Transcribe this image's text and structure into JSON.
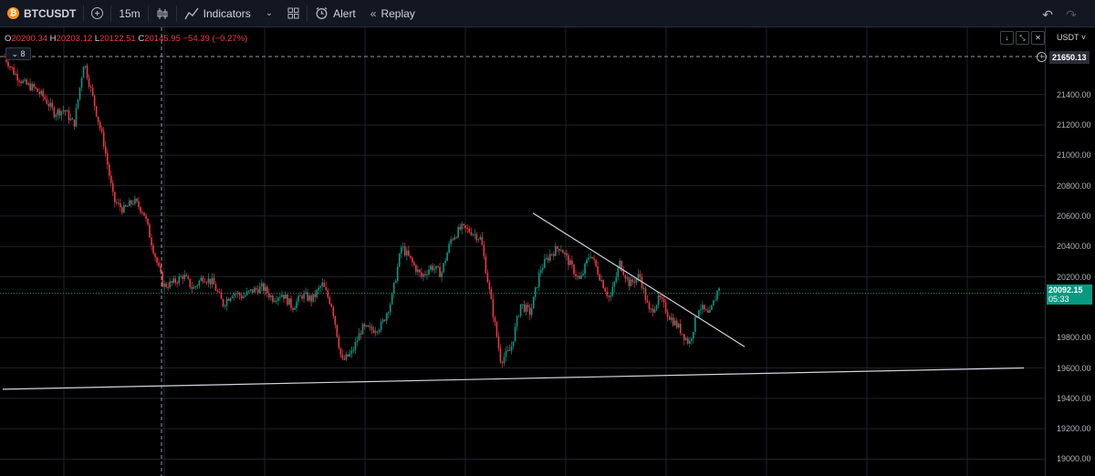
{
  "toolbar": {
    "symbol": "BTCUSDT",
    "interval": "15m",
    "indicators_label": "Indicators",
    "alert_label": "Alert",
    "replay_label": "Replay"
  },
  "legend": {
    "o_key": "O",
    "o": "20200.34",
    "h_key": "H",
    "h": "20203.12",
    "l_key": "L",
    "l": "20122.51",
    "c_key": "C",
    "c": "20145.95",
    "change": "−54.39 (−0.27%)",
    "collapsed_count": "8"
  },
  "price_axis": {
    "unit": "USDT",
    "crosshair_price": "21650.13",
    "last_price": "20092.15",
    "countdown": "05:33",
    "ticks": [
      "21400.00",
      "21200.00",
      "21000.00",
      "20800.00",
      "20600.00",
      "20400.00",
      "20200.00",
      "19800.00",
      "19600.00",
      "19400.00",
      "19200.00",
      "19000.00"
    ]
  },
  "colors": {
    "up": "#089981",
    "down": "#f23645",
    "background": "#000000",
    "grid": "#1e222d"
  },
  "chart_data": {
    "type": "candlestick",
    "ylim": [
      18900,
      21780
    ],
    "close_path": [
      21650,
      21540,
      21470,
      21440,
      21380,
      21280,
      21300,
      21200,
      21620,
      21350,
      21080,
      20700,
      20640,
      20700,
      20630,
      20380,
      20140,
      20160,
      20210,
      20120,
      20200,
      20160,
      20020,
      20100,
      20070,
      20110,
      20130,
      20060,
      20090,
      20000,
      20080,
      20050,
      20150,
      20010,
      19640,
      19700,
      19860,
      19850,
      19880,
      20050,
      20400,
      20300,
      20200,
      20270,
      20220,
      20450,
      20520,
      20500,
      20450,
      20050,
      19650,
      19720,
      20020,
      19960,
      20250,
      20350,
      20400,
      20280,
      20170,
      20360,
      20200,
      20050,
      20290,
      20150,
      20210,
      19960,
      20060,
      19940,
      19860,
      19760,
      20010,
      19940,
      20140
    ],
    "x_range": [
      0,
      72
    ]
  }
}
